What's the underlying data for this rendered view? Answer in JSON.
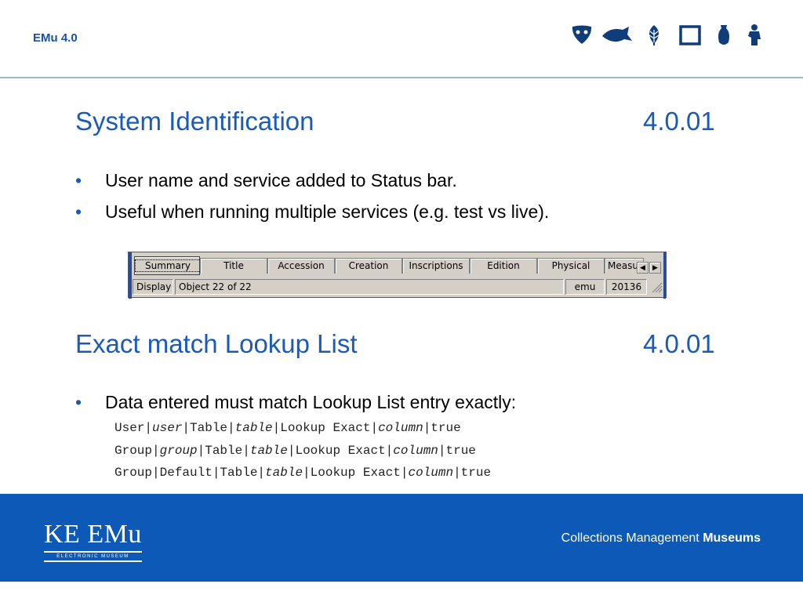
{
  "header": {
    "brand": "EMu 4.0"
  },
  "icons": [
    "mask-icon",
    "fish-icon",
    "leaf-icon",
    "frame-icon",
    "vase-icon",
    "figure-icon"
  ],
  "colors": {
    "title": "#1a5ab8",
    "footer": "#0d59b7"
  },
  "section1": {
    "title": "System Identification",
    "version": "4.0.01",
    "bullets": [
      "User name and service added to Status bar.",
      "Useful when running multiple services (e.g. test vs live)."
    ]
  },
  "widget": {
    "tabs": [
      "Summary",
      "Title",
      "Accession",
      "Creation",
      "Inscriptions",
      "Edition",
      "Physical",
      "Measu"
    ],
    "status": {
      "mode": "Display",
      "record": "Object 22 of 22",
      "user": "emu",
      "service": "20136"
    }
  },
  "section2": {
    "title": "Exact match Lookup List",
    "version": "4.0.01",
    "bullet": "Data entered must match Lookup List entry exactly:",
    "code": [
      [
        "User|",
        "user",
        "|Table|",
        "table",
        "|Lookup Exact|",
        "column",
        "|true"
      ],
      [
        "Group|",
        "group",
        "|Table|",
        "table",
        "|Lookup Exact|",
        "column",
        "|true"
      ],
      [
        "Group|Default|Table|",
        "table",
        "|Lookup Exact|",
        "column",
        "|true"
      ]
    ]
  },
  "footer": {
    "logo": "KE EMu",
    "logo_sub": "ELECTRONIC MUSEUM",
    "tagline_plain": "Collections Management",
    "tagline_bold": "Museums"
  }
}
